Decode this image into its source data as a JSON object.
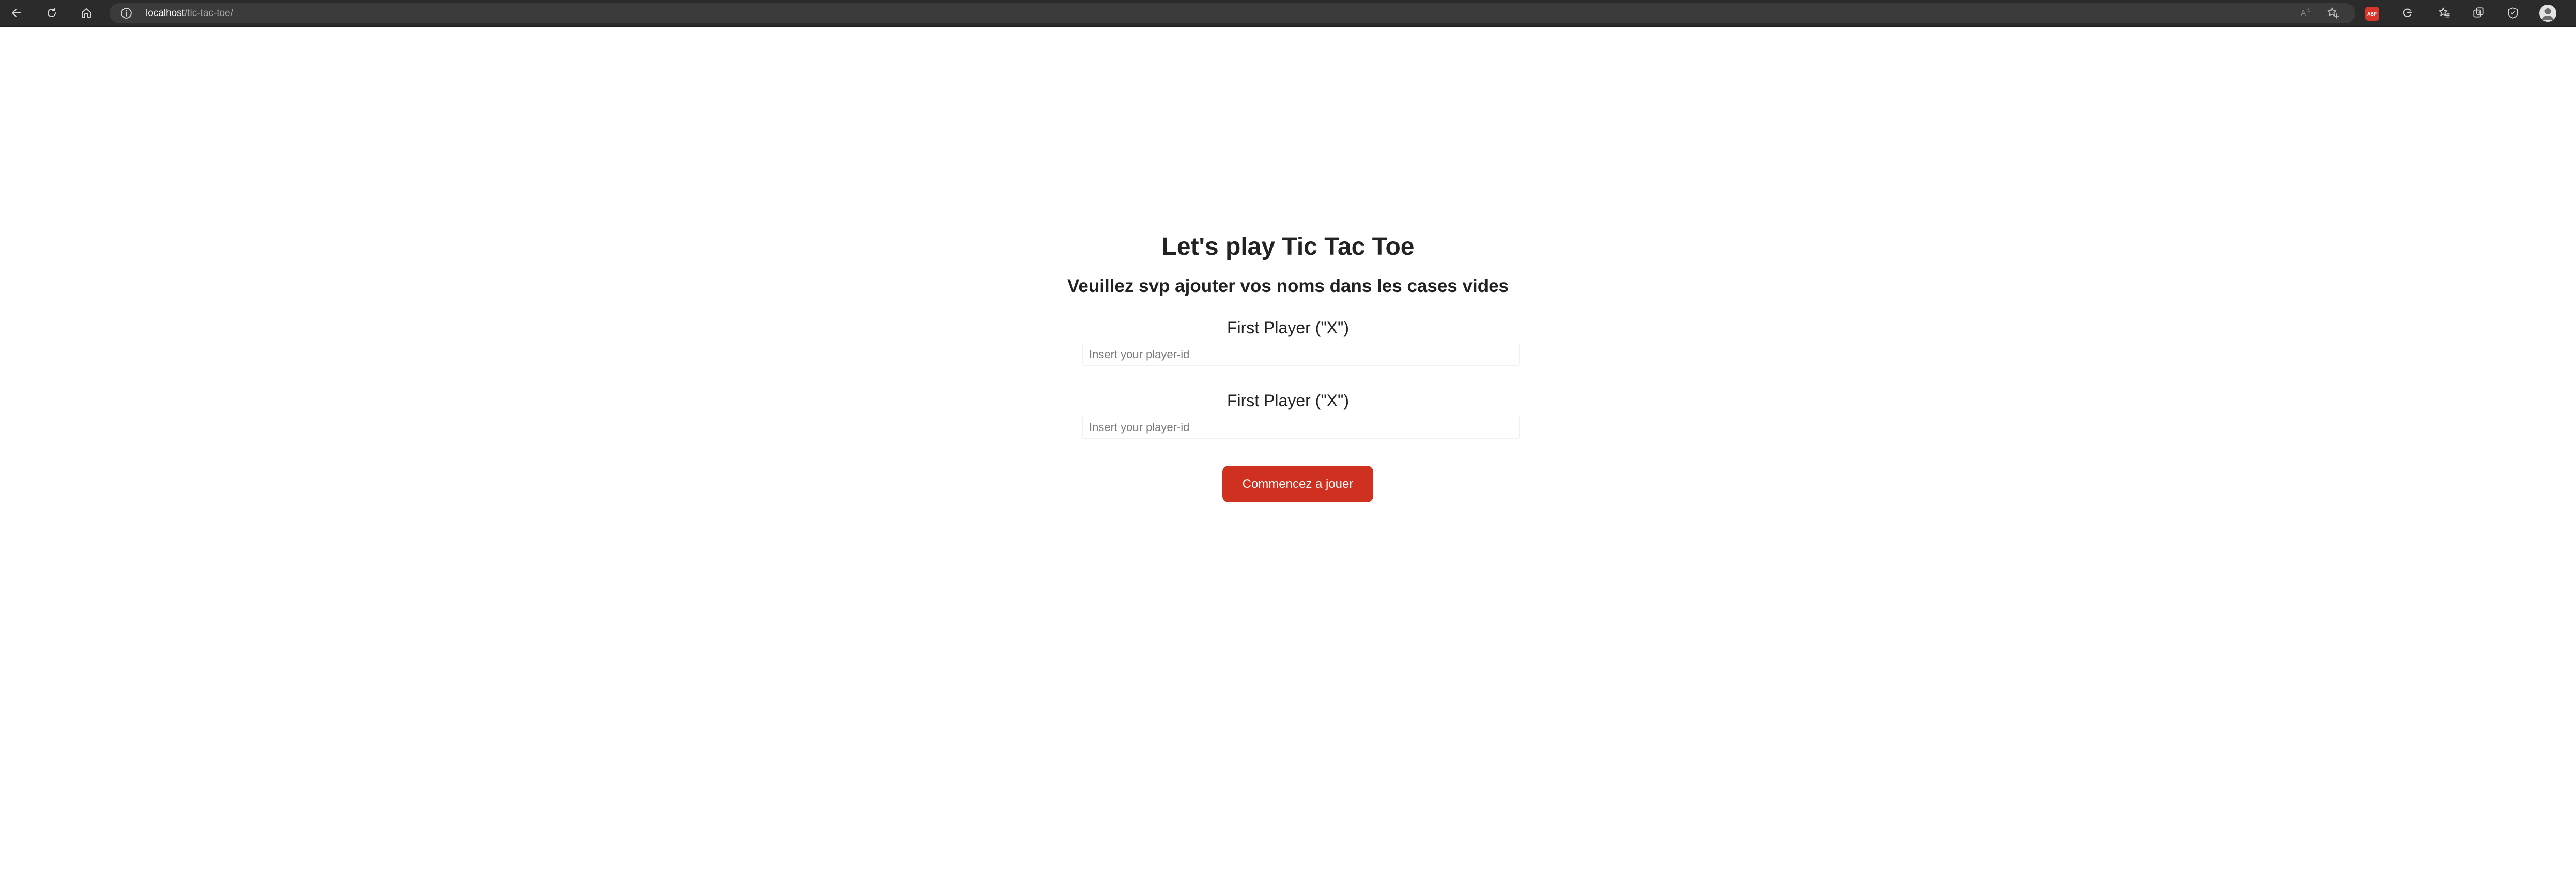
{
  "browser": {
    "url_host": "localhost",
    "url_path": "/tic-tac-toe/",
    "icons": {
      "back": "back-arrow-icon",
      "reload": "reload-icon",
      "home": "home-icon",
      "info": "info-icon",
      "read_aloud": "read-aloud-icon",
      "favorites_add": "add-favorite-icon",
      "adblock": "adblock-extension-icon",
      "extension_c": "extension-icon",
      "favorites": "favorites-icon",
      "collections": "collections-icon",
      "browser_essentials": "browser-essentials-icon",
      "profile": "profile-avatar"
    },
    "adblock_text": "ABP"
  },
  "page": {
    "title": "Let's play Tic Tac Toe",
    "subtitle": "Veuillez svp ajouter vos noms dans les cases vides",
    "player1": {
      "label": "First Player (\"X\")",
      "value": "",
      "placeholder": "Insert your player-id"
    },
    "player2": {
      "label": "First Player (\"X\")",
      "value": "",
      "placeholder": "Insert your player-id"
    },
    "start_button": "Commencez a jouer"
  },
  "colors": {
    "toolbar_bg": "#2b2b2b",
    "address_bg": "#3b3b3b",
    "button_bg": "#d0301f",
    "text": "#222222"
  }
}
